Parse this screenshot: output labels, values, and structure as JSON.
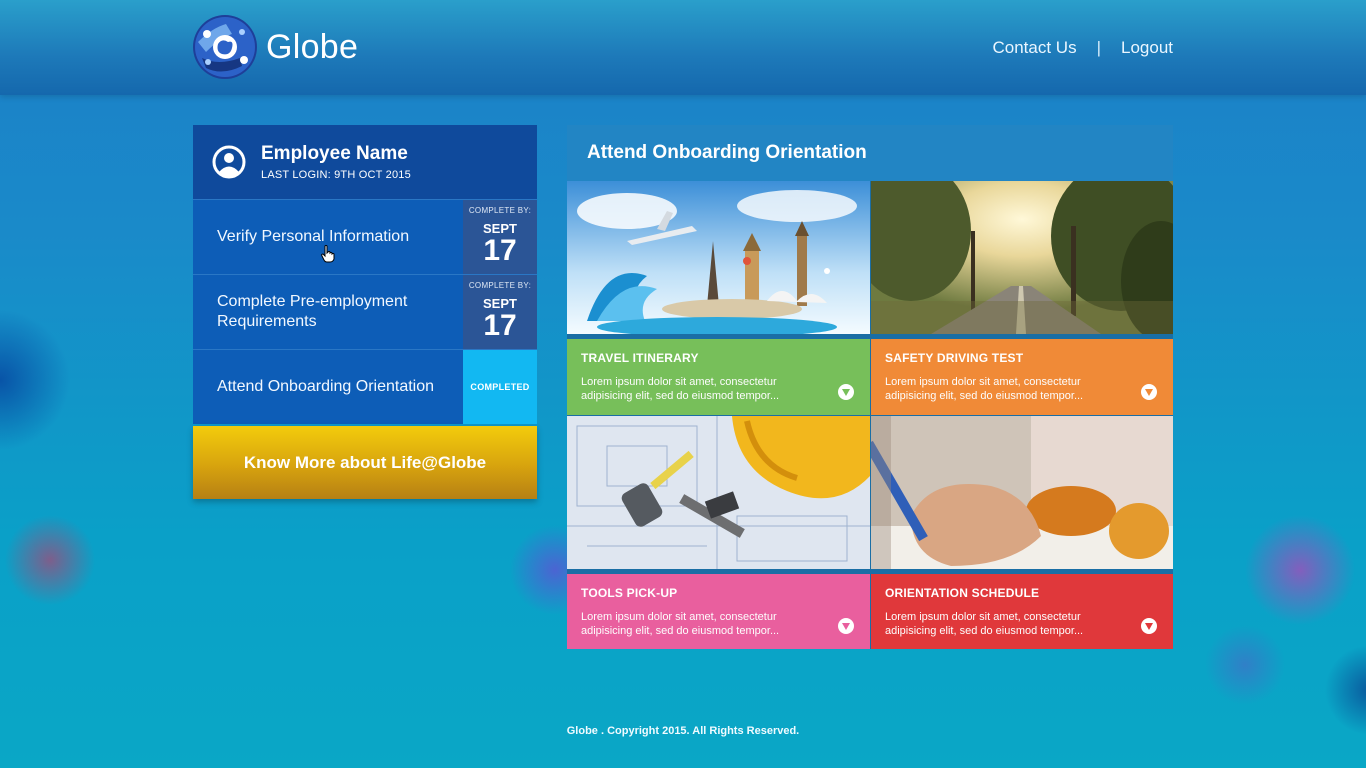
{
  "header": {
    "logo_text": "Globe",
    "nav": {
      "contact": "Contact Us",
      "separator": "|",
      "logout": "Logout"
    }
  },
  "profile": {
    "name": "Employee Name",
    "last_login": "LAST LOGIN: 9TH OCT 2015"
  },
  "tasks": [
    {
      "label": "Verify Personal Information",
      "complete_by": "COMPLETE BY:",
      "month": "SEPT",
      "day": "17"
    },
    {
      "label": "Complete Pre-employment Requirements",
      "complete_by": "COMPLETE BY:",
      "month": "SEPT",
      "day": "17"
    },
    {
      "label": "Attend Onboarding Orientation",
      "status": "COMPLETED"
    }
  ],
  "know_more": "Know More about Life@Globe",
  "main": {
    "title": "Attend Onboarding Orientation",
    "cards": [
      {
        "title": "TRAVEL ITINERARY",
        "desc": "Lorem ipsum dolor sit amet, consectetur adipisicing elit, sed do eiusmod tempor...",
        "color": "#77bf5a"
      },
      {
        "title": "SAFETY DRIVING TEST",
        "desc": "Lorem ipsum dolor sit amet, consectetur adipisicing elit, sed do eiusmod tempor...",
        "color": "#f08a37"
      },
      {
        "title": "TOOLS PICK-UP",
        "desc": "Lorem ipsum dolor sit amet, consectetur adipisicing elit, sed do eiusmod tempor...",
        "color": "#e95f9e"
      },
      {
        "title": "ORIENTATION SCHEDULE",
        "desc": "Lorem ipsum dolor sit amet, consectetur adipisicing elit, sed do eiusmod tempor...",
        "color": "#e0383b"
      }
    ]
  },
  "footer": "Globe . Copyright 2015. All Rights Reserved.",
  "icons": {
    "logo": "globe-logo-icon",
    "avatar": "user-icon",
    "expand": "chevron-down-icon",
    "cursor": "hand-cursor-icon"
  }
}
